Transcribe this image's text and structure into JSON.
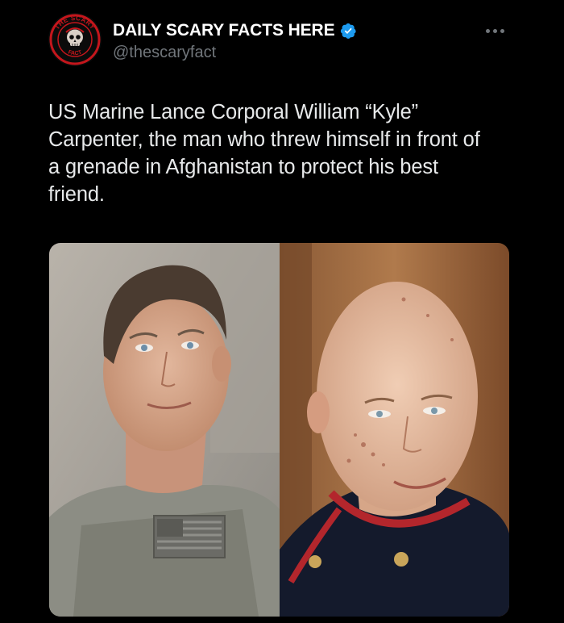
{
  "post": {
    "author": {
      "display_name": "DAILY SCARY FACTS HERE",
      "handle": "@thescaryfact",
      "verified": true,
      "avatar_icon": "skull-badge-icon",
      "avatar_ring_text_top": "THE SCARY",
      "avatar_ring_text_bottom": "FACT"
    },
    "more_icon": "ellipsis-icon",
    "text": "US Marine Lance Corporal William “Kyle”\nCarpenter, the man who threw himself in front of\na grenade in Afghanistan to protect his best\nfriend.",
    "media": {
      "type": "photo",
      "panels": [
        "soldier-in-combat-gear",
        "marine-in-dress-blues"
      ]
    }
  },
  "colors": {
    "background": "#000000",
    "primary_text": "#e7e9ea",
    "secondary_text": "#71767b",
    "verified_blue": "#1d9bf0",
    "avatar_red": "#c4161c"
  }
}
